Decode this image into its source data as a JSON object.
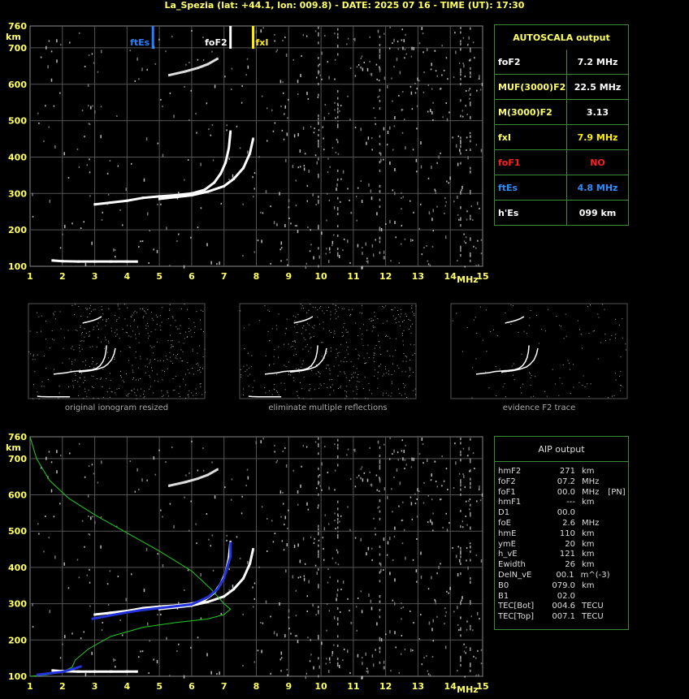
{
  "header": {
    "title": "La_Spezia (lat: +44.1, lon: 009.8) - DATE: 2025 07 16 - TIME (UT): 17:30"
  },
  "axes": {
    "y_unit": "km",
    "x_unit": "MHz",
    "y_ticks": [
      "760",
      "700",
      "600",
      "500",
      "400",
      "300",
      "200",
      "100"
    ],
    "x_ticks": [
      "1",
      "2",
      "3",
      "4",
      "5",
      "6",
      "7",
      "8",
      "9",
      "10",
      "11",
      "12",
      "13",
      "14",
      "15"
    ]
  },
  "markers": {
    "ftEs": {
      "label": "ftEs",
      "freq": 4.8,
      "color": "#2a7fff"
    },
    "foF2": {
      "label": "foF2",
      "freq": 7.2,
      "color": "#ffffff"
    },
    "fxI": {
      "label": "fxI",
      "freq": 7.9,
      "color": "#ffee00"
    }
  },
  "autoscala": {
    "title": "AUTOSCALA output",
    "rows": [
      {
        "key": "foF2",
        "value": "7.2 MHz",
        "key_color": "#ffffff",
        "val_color": "#ffffff"
      },
      {
        "key": "MUF(3000)F2",
        "value": "22.5 MHz",
        "key_color": "#ffff66",
        "val_color": "#ffffff"
      },
      {
        "key": "M(3000)F2",
        "value": "3.13",
        "key_color": "#ffff66",
        "val_color": "#ffffff"
      },
      {
        "key": "fxI",
        "value": "7.9 MHz",
        "key_color": "#ffff66",
        "val_color": "#ffee00"
      },
      {
        "key": "foF1",
        "value": "NO",
        "key_color": "#ff2020",
        "val_color": "#ff2020"
      },
      {
        "key": "ftEs",
        "value": "4.8 MHz",
        "key_color": "#2a8fff",
        "val_color": "#2a8fff"
      },
      {
        "key": "h'Es",
        "value": "099     km",
        "key_color": "#ffffff",
        "val_color": "#ffffff"
      }
    ]
  },
  "thumbnails": [
    {
      "caption": "original ionogram resized"
    },
    {
      "caption": "eliminate multiple reflections"
    },
    {
      "caption": "evidence F2 trace"
    }
  ],
  "aip": {
    "title": "AIP output",
    "rows": [
      [
        "hmF2",
        "271",
        "km",
        ""
      ],
      [
        "foF2",
        "07.2",
        "MHz",
        ""
      ],
      [
        "foF1",
        "00.0",
        "MHz",
        "[PN]"
      ],
      [
        "hmF1",
        "---",
        "km",
        ""
      ],
      [
        "D1",
        "00.0",
        "",
        ""
      ],
      [
        "foE",
        "2.6",
        "MHz",
        ""
      ],
      [
        "hmE",
        "110",
        "km",
        ""
      ],
      [
        "ymE",
        "20",
        "km",
        ""
      ],
      [
        "h_vE",
        "121",
        "km",
        ""
      ],
      [
        "Ewidth",
        "26",
        "km",
        ""
      ],
      [
        "DelN_vE",
        "00.1",
        "m^(-3)",
        ""
      ],
      [
        "B0",
        "079.0",
        "km",
        ""
      ],
      [
        "B1",
        "02.0",
        "",
        ""
      ],
      [
        "TEC[Bot]",
        "004.6",
        "TECU",
        ""
      ],
      [
        "TEC[Top]",
        "007.1",
        "TECU",
        ""
      ]
    ]
  },
  "chart_data": {
    "type": "scatter",
    "title": "",
    "xlabel": "MHz",
    "ylabel": "km",
    "xlim": [
      1,
      15
    ],
    "ylim": [
      100,
      760
    ],
    "es_trace": [
      [
        1.7,
        116
      ],
      [
        2.0,
        114
      ],
      [
        2.5,
        113
      ],
      [
        3.0,
        113
      ],
      [
        3.5,
        113
      ],
      [
        4.0,
        113
      ],
      [
        4.3,
        113
      ]
    ],
    "f2_o_trace": [
      [
        3.0,
        270
      ],
      [
        3.5,
        275
      ],
      [
        4.0,
        280
      ],
      [
        4.5,
        288
      ],
      [
        5.0,
        292
      ],
      [
        5.5,
        295
      ],
      [
        6.0,
        300
      ],
      [
        6.4,
        310
      ],
      [
        6.7,
        330
      ],
      [
        6.9,
        355
      ],
      [
        7.05,
        385
      ],
      [
        7.15,
        425
      ],
      [
        7.2,
        470
      ]
    ],
    "f2_x_trace": [
      [
        5.0,
        285
      ],
      [
        5.5,
        290
      ],
      [
        6.0,
        295
      ],
      [
        6.5,
        305
      ],
      [
        7.0,
        320
      ],
      [
        7.3,
        340
      ],
      [
        7.6,
        370
      ],
      [
        7.8,
        410
      ],
      [
        7.9,
        450
      ]
    ],
    "f2_multi_trace": [
      [
        5.3,
        625
      ],
      [
        5.8,
        635
      ],
      [
        6.2,
        645
      ],
      [
        6.5,
        655
      ],
      [
        6.8,
        670
      ]
    ],
    "aip_profile": [
      [
        1.0,
        760
      ],
      [
        1.2,
        700
      ],
      [
        1.6,
        640
      ],
      [
        2.2,
        590
      ],
      [
        3.0,
        545
      ],
      [
        4.0,
        495
      ],
      [
        5.0,
        445
      ],
      [
        6.0,
        390
      ],
      [
        6.6,
        340
      ],
      [
        7.0,
        300
      ],
      [
        7.2,
        285
      ],
      [
        7.0,
        270
      ],
      [
        6.5,
        258
      ],
      [
        5.5,
        248
      ],
      [
        4.5,
        235
      ],
      [
        3.5,
        210
      ],
      [
        2.8,
        175
      ],
      [
        2.4,
        145
      ],
      [
        2.3,
        125
      ],
      [
        2.0,
        112
      ],
      [
        1.5,
        104
      ],
      [
        1.0,
        100
      ]
    ],
    "aip_fit": [
      [
        2.9,
        258
      ],
      [
        3.5,
        268
      ],
      [
        4.0,
        276
      ],
      [
        4.5,
        283
      ],
      [
        5.0,
        288
      ],
      [
        5.5,
        293
      ],
      [
        6.0,
        298
      ],
      [
        6.5,
        318
      ],
      [
        6.8,
        340
      ],
      [
        7.0,
        370
      ],
      [
        7.1,
        400
      ],
      [
        7.2,
        430
      ],
      [
        7.2,
        470
      ]
    ],
    "aip_e_fit": [
      [
        1.2,
        104
      ],
      [
        1.6,
        108
      ],
      [
        2.0,
        112
      ],
      [
        2.4,
        122
      ],
      [
        2.6,
        128
      ]
    ]
  }
}
